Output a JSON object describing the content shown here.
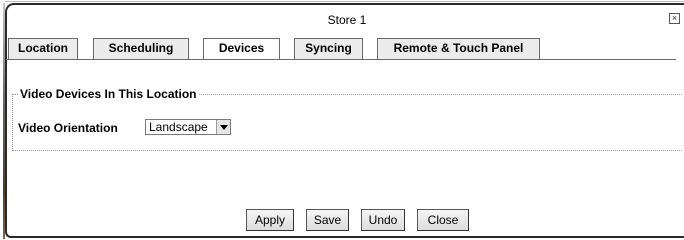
{
  "dialog": {
    "title": "Store 1",
    "close_symbol": "×"
  },
  "tabs": [
    {
      "label": "Location",
      "active": false
    },
    {
      "label": "Scheduling",
      "active": false
    },
    {
      "label": "Devices",
      "active": true
    },
    {
      "label": "Syncing",
      "active": false
    },
    {
      "label": "Remote & Touch Panel",
      "active": false
    }
  ],
  "devices": {
    "section_legend": "Video Devices In This Location",
    "orientation_label": "Video Orientation",
    "orientation_value": "Landscape"
  },
  "buttons": {
    "apply": "Apply",
    "save": "Save",
    "undo": "Undo",
    "close": "Close"
  }
}
